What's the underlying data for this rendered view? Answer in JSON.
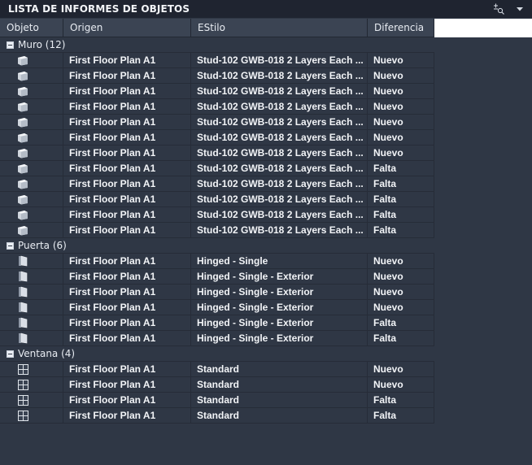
{
  "panel": {
    "title": "LISTA DE INFORMES DE OBJETOS"
  },
  "columns": {
    "objeto": "Objeto",
    "origen": "Origen",
    "estilo": "EStilo",
    "diferencia": "Diferencia"
  },
  "groups": [
    {
      "label": "Muro (12)",
      "icon": "wall-icon",
      "rows": [
        {
          "origen": "First Floor Plan A1",
          "estilo": "Stud-102 GWB-018 2 Layers Each ...",
          "diferencia": "Nuevo"
        },
        {
          "origen": "First Floor Plan A1",
          "estilo": "Stud-102 GWB-018 2 Layers Each ...",
          "diferencia": "Nuevo"
        },
        {
          "origen": "First Floor Plan A1",
          "estilo": "Stud-102 GWB-018 2 Layers Each ...",
          "diferencia": "Nuevo"
        },
        {
          "origen": "First Floor Plan A1",
          "estilo": "Stud-102 GWB-018 2 Layers Each ...",
          "diferencia": "Nuevo"
        },
        {
          "origen": "First Floor Plan A1",
          "estilo": "Stud-102 GWB-018 2 Layers Each ...",
          "diferencia": "Nuevo"
        },
        {
          "origen": "First Floor Plan A1",
          "estilo": "Stud-102 GWB-018 2 Layers Each ...",
          "diferencia": "Nuevo"
        },
        {
          "origen": "First Floor Plan A1",
          "estilo": "Stud-102 GWB-018 2 Layers Each ...",
          "diferencia": "Nuevo"
        },
        {
          "origen": "First Floor Plan A1",
          "estilo": "Stud-102 GWB-018 2 Layers Each ...",
          "diferencia": "Falta"
        },
        {
          "origen": "First Floor Plan A1",
          "estilo": "Stud-102 GWB-018 2 Layers Each ...",
          "diferencia": "Falta"
        },
        {
          "origen": "First Floor Plan A1",
          "estilo": "Stud-102 GWB-018 2 Layers Each ...",
          "diferencia": "Falta"
        },
        {
          "origen": "First Floor Plan A1",
          "estilo": "Stud-102 GWB-018 2 Layers Each ...",
          "diferencia": "Falta"
        },
        {
          "origen": "First Floor Plan A1",
          "estilo": "Stud-102 GWB-018 2 Layers Each ...",
          "diferencia": "Falta"
        }
      ]
    },
    {
      "label": "Puerta (6)",
      "icon": "door-icon",
      "rows": [
        {
          "origen": "First Floor Plan A1",
          "estilo": "Hinged - Single",
          "diferencia": "Nuevo"
        },
        {
          "origen": "First Floor Plan A1",
          "estilo": "Hinged - Single - Exterior",
          "diferencia": "Nuevo"
        },
        {
          "origen": "First Floor Plan A1",
          "estilo": "Hinged - Single - Exterior",
          "diferencia": "Nuevo"
        },
        {
          "origen": "First Floor Plan A1",
          "estilo": "Hinged - Single - Exterior",
          "diferencia": "Nuevo"
        },
        {
          "origen": "First Floor Plan A1",
          "estilo": "Hinged - Single - Exterior",
          "diferencia": "Falta"
        },
        {
          "origen": "First Floor Plan A1",
          "estilo": "Hinged - Single - Exterior",
          "diferencia": "Falta"
        }
      ]
    },
    {
      "label": "Ventana (4)",
      "icon": "window-icon",
      "rows": [
        {
          "origen": "First Floor Plan A1",
          "estilo": "Standard",
          "diferencia": "Nuevo"
        },
        {
          "origen": "First Floor Plan A1",
          "estilo": "Standard",
          "diferencia": "Nuevo"
        },
        {
          "origen": "First Floor Plan A1",
          "estilo": "Standard",
          "diferencia": "Falta"
        },
        {
          "origen": "First Floor Plan A1",
          "estilo": "Standard",
          "diferencia": "Falta"
        }
      ]
    }
  ]
}
